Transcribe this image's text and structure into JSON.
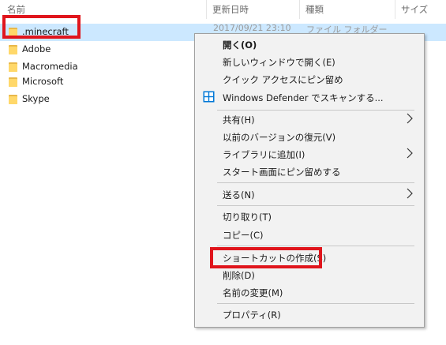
{
  "header": {
    "col_name": "名前",
    "col_modified": "更新日時",
    "col_type": "種類",
    "col_size": "サイズ",
    "sort_glyph": "^"
  },
  "files": [
    {
      "name": ".minecraft",
      "date": "2017/09/21 23:10",
      "type": "ファイル フォルダー",
      "selected": true
    },
    {
      "name": "Adobe"
    },
    {
      "name": "Macromedia"
    },
    {
      "name": "Microsoft"
    },
    {
      "name": "Skype"
    }
  ],
  "menu": {
    "open": "開く(O)",
    "open_new_window": "新しいウィンドウで開く(E)",
    "pin_quick_access": "クイック アクセスにピン留め",
    "defender_scan": "Windows Defender でスキャンする...",
    "share": "共有(H)",
    "restore_previous": "以前のバージョンの復元(V)",
    "add_to_library": "ライブラリに追加(I)",
    "pin_start": "スタート画面にピン留めする",
    "send_to": "送る(N)",
    "cut": "切り取り(T)",
    "copy": "コピー(C)",
    "create_shortcut": "ショートカットの作成(S)",
    "delete": "削除(D)",
    "rename": "名前の変更(M)",
    "properties": "プロパティ(R)"
  },
  "colors": {
    "selection": "#cce8ff",
    "highlight_border": "#e0151c",
    "menu_bg": "#f2f2f2",
    "folder": "#ffd86a",
    "defender": "#0078d7"
  },
  "icons": {
    "folder": "folder-icon",
    "defender": "windows-defender-icon",
    "submenu": "chevron-right-icon"
  }
}
